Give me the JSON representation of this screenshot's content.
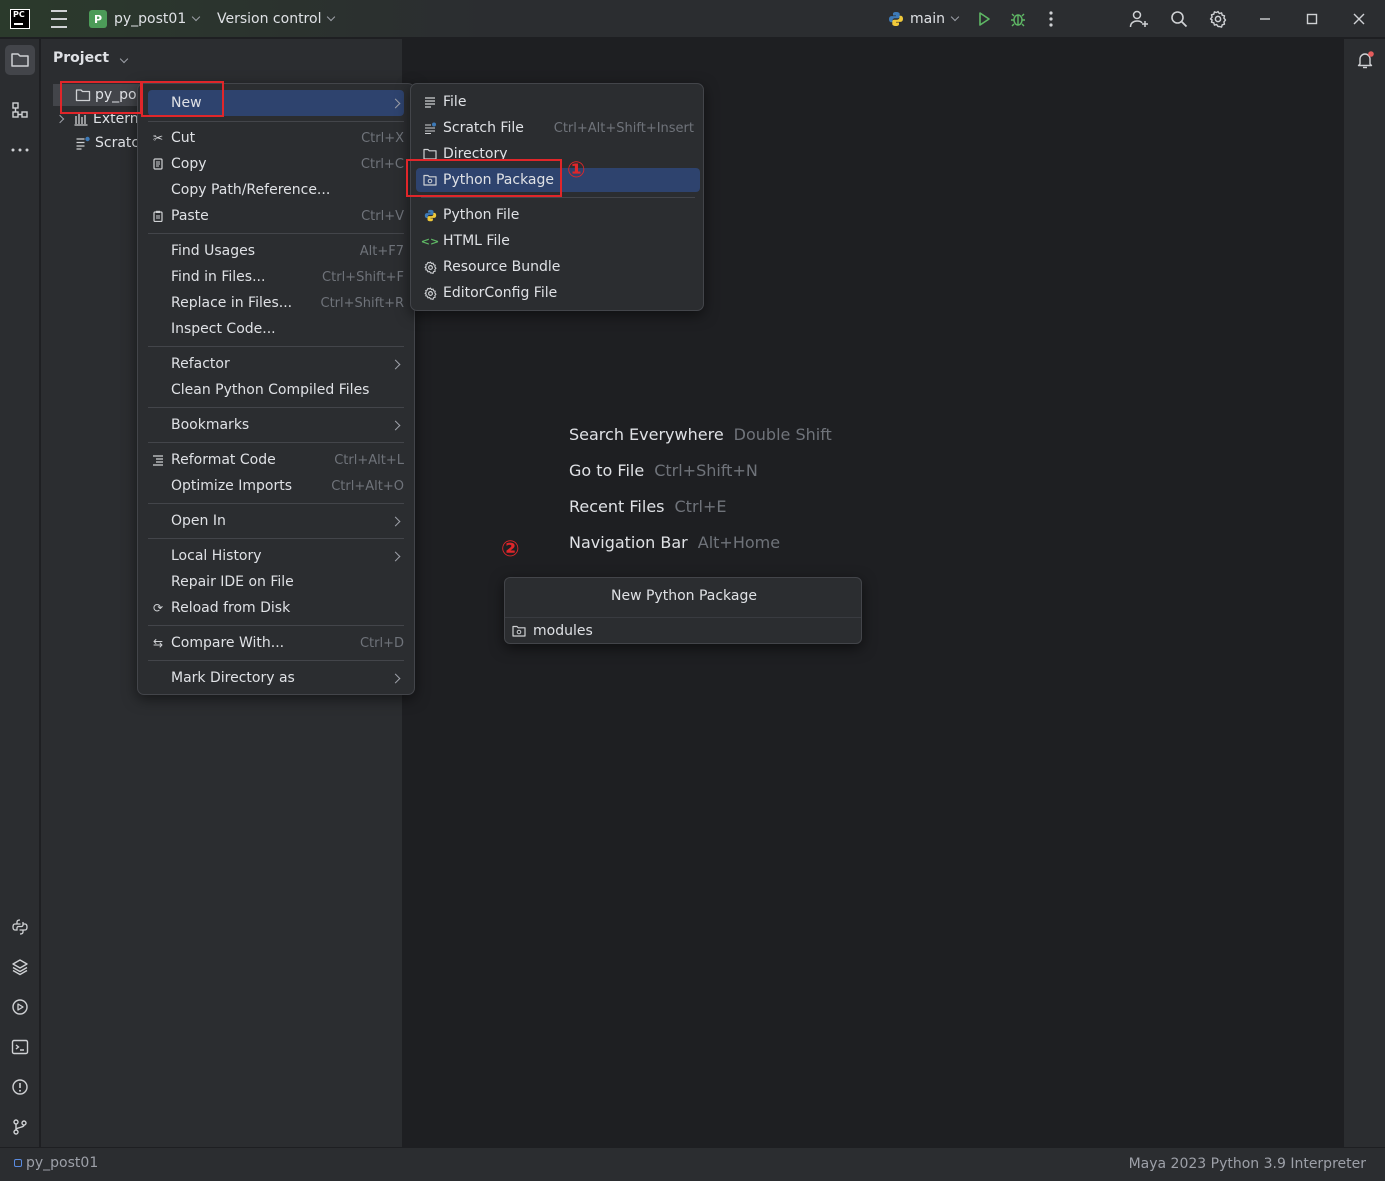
{
  "titlebar": {
    "logo_text": "PC",
    "project_badge": "P",
    "project_name": "py_post01",
    "vcs_label": "Version control",
    "run_config": "main"
  },
  "project_panel": {
    "title": "Project",
    "tree": [
      {
        "label": "py_pos",
        "icon": "folder-icon"
      },
      {
        "label": "Externa",
        "icon": "library-icon"
      },
      {
        "label": "Scratc",
        "icon": "scratch-icon"
      }
    ]
  },
  "context_menu": {
    "items": [
      {
        "label": "New",
        "key": "",
        "submenu": true
      },
      {
        "label": "Cut",
        "key": "Ctrl+X",
        "icon": "scissors-icon"
      },
      {
        "label": "Copy",
        "key": "Ctrl+C",
        "icon": "copy-icon"
      },
      {
        "label": "Copy Path/Reference...",
        "key": ""
      },
      {
        "label": "Paste",
        "key": "Ctrl+V",
        "icon": "paste-icon"
      },
      {
        "label": "Find Usages",
        "key": "Alt+F7"
      },
      {
        "label": "Find in Files...",
        "key": "Ctrl+Shift+F"
      },
      {
        "label": "Replace in Files...",
        "key": "Ctrl+Shift+R"
      },
      {
        "label": "Inspect Code...",
        "key": ""
      },
      {
        "label": "Refactor",
        "key": "",
        "submenu": true
      },
      {
        "label": "Clean Python Compiled Files",
        "key": ""
      },
      {
        "label": "Bookmarks",
        "key": "",
        "submenu": true
      },
      {
        "label": "Reformat Code",
        "key": "Ctrl+Alt+L",
        "icon": "reformat-icon"
      },
      {
        "label": "Optimize Imports",
        "key": "Ctrl+Alt+O"
      },
      {
        "label": "Open In",
        "key": "",
        "submenu": true
      },
      {
        "label": "Local History",
        "key": "",
        "submenu": true
      },
      {
        "label": "Repair IDE on File",
        "key": ""
      },
      {
        "label": "Reload from Disk",
        "key": "",
        "icon": "reload-icon"
      },
      {
        "label": "Compare With...",
        "key": "Ctrl+D",
        "icon": "compare-icon"
      },
      {
        "label": "Mark Directory as",
        "key": "",
        "submenu": true
      }
    ]
  },
  "new_submenu": {
    "items": [
      {
        "label": "File",
        "key": "",
        "icon": "file-icon"
      },
      {
        "label": "Scratch File",
        "key": "Ctrl+Alt+Shift+Insert",
        "icon": "scratch-file-icon"
      },
      {
        "label": "Directory",
        "key": "",
        "icon": "folder-icon"
      },
      {
        "label": "Python Package",
        "key": "",
        "icon": "package-icon"
      },
      {
        "label": "Python File",
        "key": "",
        "icon": "python-icon"
      },
      {
        "label": "HTML File",
        "key": "",
        "icon": "html-icon"
      },
      {
        "label": "Resource Bundle",
        "key": "",
        "icon": "gear-icon"
      },
      {
        "label": "EditorConfig File",
        "key": "",
        "icon": "gear-icon"
      }
    ]
  },
  "annotations": {
    "marker1": "①",
    "marker2": "②",
    "color": "#e0262a"
  },
  "editor_hints": [
    {
      "label": "Search Everywhere",
      "shortcut": "Double Shift"
    },
    {
      "label": "Go to File",
      "shortcut": "Ctrl+Shift+N"
    },
    {
      "label": "Recent Files",
      "shortcut": "Ctrl+E"
    },
    {
      "label": "Navigation Bar",
      "shortcut": "Alt+Home"
    }
  ],
  "new_package_popup": {
    "title": "New Python Package",
    "value": "modules"
  },
  "statusbar": {
    "project": "py_post01",
    "interpreter": "Maya 2023 Python 3.9 Interpreter"
  },
  "colors": {
    "accent": "#2e436e",
    "background": "#1e1f22",
    "panel": "#2b2d30",
    "highlight_box": "#e0262a"
  }
}
